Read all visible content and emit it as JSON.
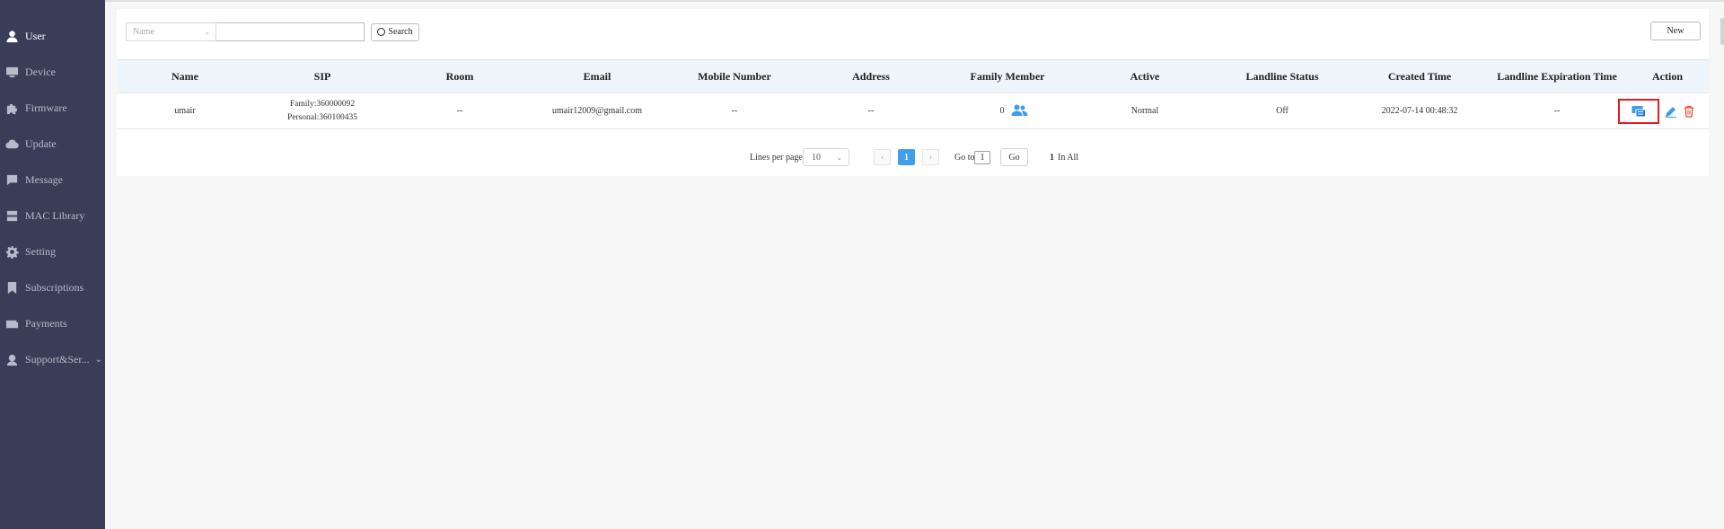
{
  "sidebar": {
    "items": [
      {
        "label": "User",
        "icon": "user-icon",
        "active": true
      },
      {
        "label": "Device",
        "icon": "device-icon"
      },
      {
        "label": "Firmware",
        "icon": "puzzle-icon"
      },
      {
        "label": "Update",
        "icon": "cloud-upload-icon"
      },
      {
        "label": "Message",
        "icon": "chat-icon"
      },
      {
        "label": "MAC Library",
        "icon": "server-icon"
      },
      {
        "label": "Setting",
        "icon": "gear-icon"
      },
      {
        "label": "Subscriptions",
        "icon": "bookmark-icon"
      },
      {
        "label": "Payments",
        "icon": "wallet-icon"
      },
      {
        "label": "Support&Ser...",
        "icon": "headset-icon",
        "expandable": true
      }
    ]
  },
  "toolbar": {
    "filter_selected": "Name",
    "search_value": "",
    "search_label": "Search",
    "new_label": "New"
  },
  "table": {
    "columns": [
      "Name",
      "SIP",
      "Room",
      "Email",
      "Mobile Number",
      "Address",
      "Family Member",
      "Active",
      "Landline Status",
      "Created Time",
      "Landline Expiration Time",
      "Action"
    ],
    "rows": [
      {
        "name": "umair",
        "sip_family": "Family:360000092",
        "sip_personal": "Personal:360100435",
        "room": "--",
        "email": "umair12009@gmail.com",
        "mobile": "--",
        "address": "--",
        "family_member": "0",
        "active": "Normal",
        "landline_status": "Off",
        "created_time": "2022-07-14 00:48:32",
        "landline_expiration": "--"
      }
    ]
  },
  "pagination": {
    "lines_label": "Lines per page",
    "lines_value": "10",
    "prev": "‹",
    "next": "›",
    "current_page": "1",
    "goto_label": "Go to",
    "goto_value": "1",
    "go_label": "Go",
    "total_count": "1",
    "total_label": "In All"
  },
  "colors": {
    "sidebar_bg": "#3a3d57",
    "accent_blue": "#419eea",
    "highlight_red": "#e31b23",
    "delete_red": "#e74c3c"
  }
}
